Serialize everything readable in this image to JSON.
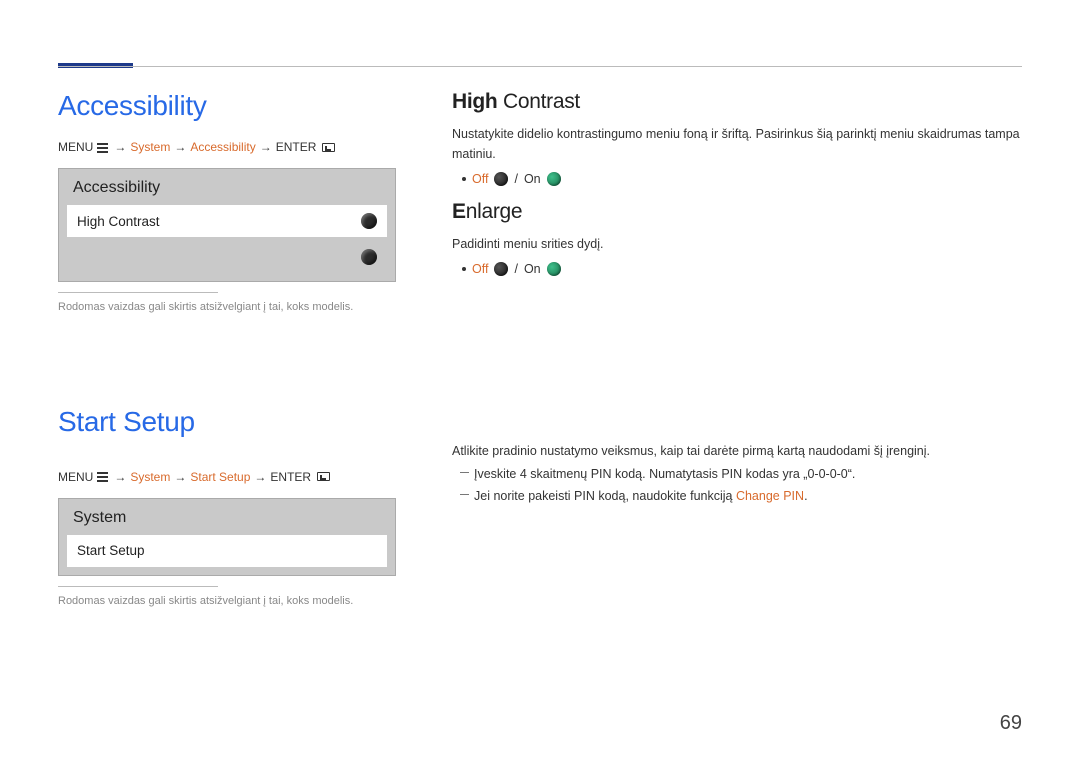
{
  "page_number": "69",
  "accessibility": {
    "heading": "Accessibility",
    "breadcrumb": {
      "menu": "MENU",
      "system": "System",
      "current": "Accessibility",
      "enter": "ENTER"
    },
    "panel": {
      "title": "Accessibility",
      "row1_label": "High Contrast"
    },
    "caption": "Rodomas vaizdas gali skirtis atsižvelgiant į tai, koks modelis."
  },
  "high_contrast": {
    "heading_first": "High",
    "heading_rest": " Contrast",
    "body": "Nustatykite didelio kontrastingumo meniu foną ir šriftą. Pasirinkus šią parinktį meniu skaidrumas tampa matiniu.",
    "off": "Off",
    "on": "On"
  },
  "enlarge": {
    "heading_first": "E",
    "heading_rest": "nlarge",
    "body": "Padidinti meniu srities dydį.",
    "off": "Off",
    "on": "On"
  },
  "start_setup": {
    "heading": "Start Setup",
    "breadcrumb": {
      "menu": "MENU",
      "system": "System",
      "current": "Start Setup",
      "enter": "ENTER"
    },
    "panel": {
      "title": "System",
      "row1_label": "Start Setup"
    },
    "caption": "Rodomas vaizdas gali skirtis atsižvelgiant į tai, koks modelis.",
    "right_intro": "Atlikite pradinio nustatymo veiksmus, kaip tai darėte pirmą kartą naudodami šį įrenginį.",
    "right_step1": "Įveskite 4 skaitmenų PIN kodą. Numatytasis PIN kodas yra „0-0-0-0“.",
    "right_step2_a": "Jei norite pakeisti PIN kodą, naudokite funkciją ",
    "right_step2_b": "Change PIN",
    "right_step2_c": "."
  }
}
